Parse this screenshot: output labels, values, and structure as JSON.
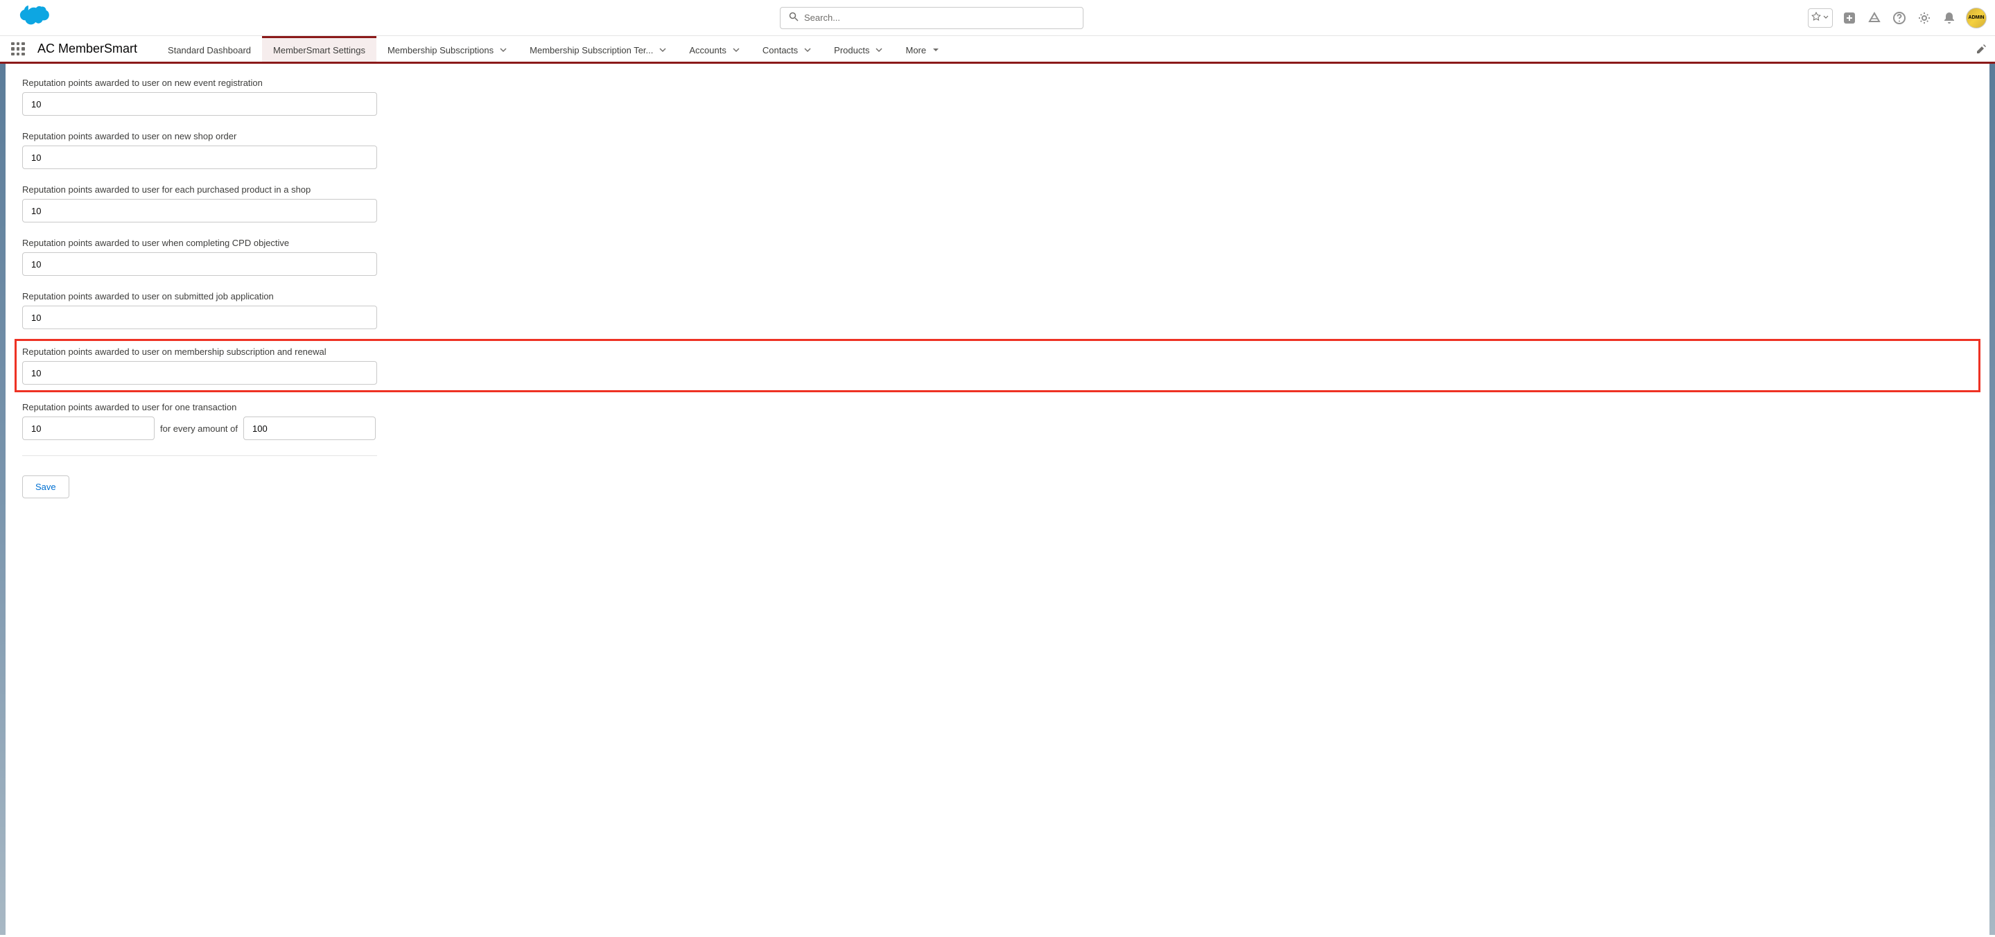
{
  "header": {
    "search_placeholder": "Search...",
    "avatar_label": "ADMIN"
  },
  "nav": {
    "app_name": "AC MemberSmart",
    "items": [
      {
        "label": "Standard Dashboard",
        "dropdown": false,
        "active": false
      },
      {
        "label": "MemberSmart Settings",
        "dropdown": false,
        "active": true
      },
      {
        "label": "Membership Subscriptions",
        "dropdown": true,
        "active": false
      },
      {
        "label": "Membership Subscription Ter...",
        "dropdown": true,
        "active": false
      },
      {
        "label": "Accounts",
        "dropdown": true,
        "active": false
      },
      {
        "label": "Contacts",
        "dropdown": true,
        "active": false
      },
      {
        "label": "Products",
        "dropdown": true,
        "active": false
      },
      {
        "label": "More",
        "dropdown": true,
        "active": false
      }
    ]
  },
  "form": {
    "fields": [
      {
        "label": "Reputation points awarded to user on new event registration",
        "value": "10"
      },
      {
        "label": "Reputation points awarded to user on new shop order",
        "value": "10"
      },
      {
        "label": "Reputation points awarded to user for each purchased product in a shop",
        "value": "10"
      },
      {
        "label": "Reputation points awarded to user when completing CPD objective",
        "value": "10"
      },
      {
        "label": "Reputation points awarded to user on submitted job application",
        "value": "10"
      },
      {
        "label": "Reputation points awarded to user on membership subscription and renewal",
        "value": "10"
      }
    ],
    "transaction": {
      "label": "Reputation points awarded to user for one transaction",
      "points_value": "10",
      "amount_text": "for every amount of",
      "amount_value": "100"
    },
    "save_label": "Save"
  }
}
